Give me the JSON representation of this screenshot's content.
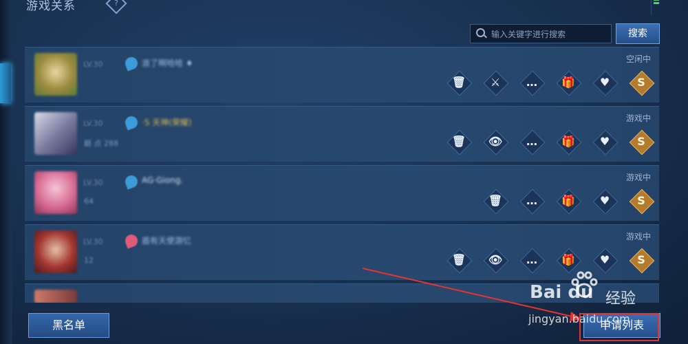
{
  "header": {
    "title": "游戏关系",
    "help_symbol": "?"
  },
  "search": {
    "placeholder": "输入关键字进行搜索",
    "button_label": "搜索"
  },
  "rows": [
    {
      "status": "空闲中",
      "lv": "LV.30",
      "name": "浪了啊哈哈 ♦",
      "sub": "",
      "actions": [
        "trash-icon",
        "battle-icon",
        "chat-icon",
        "gift-icon",
        "heart-card-icon",
        "coin-icon"
      ],
      "action_glyphs": [
        "🗑",
        "⚔",
        "…",
        "🎁",
        "♥",
        "S"
      ]
    },
    {
      "status": "游戏中",
      "lv": "LV.30",
      "name": "·S 天神(荣耀)",
      "sub": "巅 点 288",
      "actions": [
        "trash-icon",
        "eye-icon",
        "chat-icon",
        "gift-icon",
        "heart-card-icon",
        "coin-icon"
      ],
      "action_glyphs": [
        "🗑",
        "👁",
        "…",
        "🎁",
        "♥",
        "S"
      ]
    },
    {
      "status": "游戏中",
      "lv": "LV.30",
      "name": "AG·Giong.",
      "sub": "64",
      "actions": [
        "trash-icon",
        "chat-icon",
        "gift-icon",
        "heart-card-icon",
        "coin-icon"
      ],
      "action_glyphs": [
        "🗑",
        "…",
        "🎁",
        "♥",
        "S"
      ]
    },
    {
      "status": "游戏中",
      "lv": "LV.30",
      "name": "盾有天使游忆",
      "sub": "12",
      "actions": [
        "trash-icon",
        "eye-icon",
        "chat-icon",
        "gift-icon",
        "heart-card-icon",
        "coin-icon"
      ],
      "action_glyphs": [
        "🗑",
        "👁",
        "…",
        "🎁",
        "♥",
        "S"
      ]
    }
  ],
  "footer": {
    "blacklist_label": "黑名单",
    "apply_list_label": "申请列表"
  },
  "watermark": {
    "logo": "Bai du",
    "jy": "经验",
    "url": "jingyan.baidu.com"
  },
  "colors": {
    "accent": "#3a6fb5",
    "annotation_red": "#e53333"
  }
}
